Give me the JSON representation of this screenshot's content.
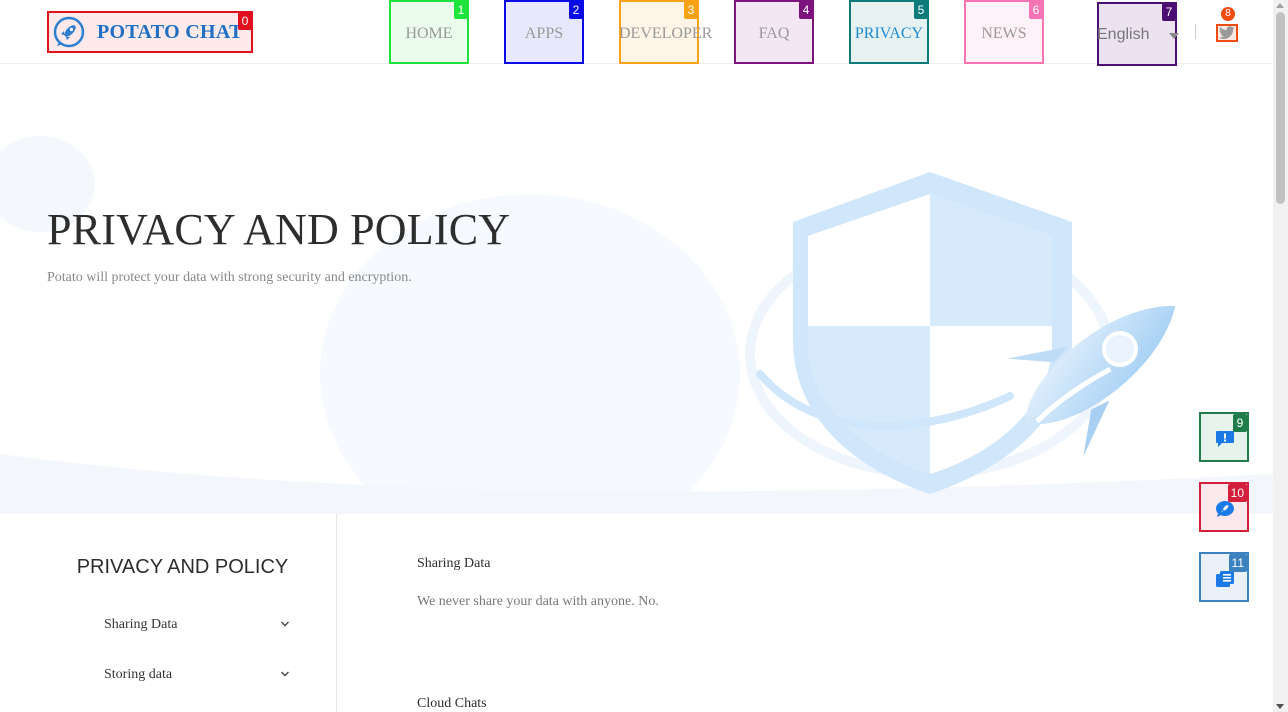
{
  "header": {
    "brand": {
      "name": "POTATO CHAT",
      "tag": "0",
      "tag_color": "#e0101c"
    },
    "nav": [
      {
        "label": "HOME",
        "tag": "1",
        "color": "#1ee33a",
        "bg": "#ebfced"
      },
      {
        "label": "APPS",
        "tag": "2",
        "color": "#0a0ae6",
        "bg": "#e8e8fc"
      },
      {
        "label": "DEVELOPER",
        "tag": "3",
        "color": "#f6a214",
        "bg": "#fef5e6"
      },
      {
        "label": "FAQ",
        "tag": "4",
        "color": "#7d137d",
        "bg": "#f2e7f2"
      },
      {
        "label": "PRIVACY",
        "tag": "5",
        "color": "#0e7b7b",
        "bg": "#e6f2f2",
        "active": true
      },
      {
        "label": "NEWS",
        "tag": "6",
        "color": "#f774b4",
        "bg": "#fef1f7"
      }
    ],
    "language": {
      "label": "English",
      "tag": "7"
    },
    "twitter": {
      "icon": "twitter-icon",
      "tag": "8"
    }
  },
  "hero": {
    "title": "PRIVACY AND POLICY",
    "subtitle": "Potato will protect your data with strong security and encryption.",
    "illustration": "shield-rocket-illustration"
  },
  "float_buttons": [
    {
      "icon": "feedback-icon",
      "tag": "9",
      "color": "#1e7d4a",
      "bg": "#e6f2ec"
    },
    {
      "icon": "chat-icon",
      "tag": "10",
      "color": "#d31e3c",
      "bg": "#fae8ec"
    },
    {
      "icon": "list-icon",
      "tag": "11",
      "color": "#3c82be",
      "bg": "#eaf1f8"
    }
  ],
  "sidebar": {
    "title": "PRIVACY AND POLICY",
    "items": [
      {
        "label": "Sharing Data"
      },
      {
        "label": "Storing data"
      }
    ]
  },
  "sections": [
    {
      "title": "Sharing Data",
      "body": "We never share your data with anyone. No."
    },
    {
      "title": "Cloud Chats",
      "body": ""
    }
  ],
  "colors": {
    "accent": "#1f8ad0",
    "brand": "#1f6fc5",
    "illustration": "#cfe6fb"
  }
}
